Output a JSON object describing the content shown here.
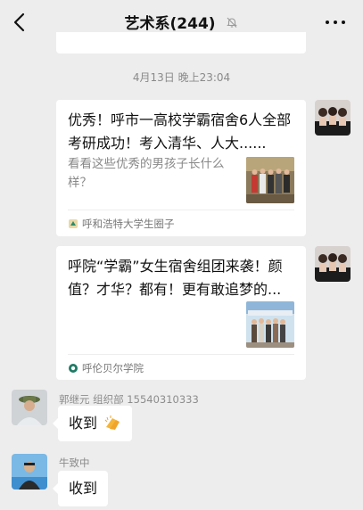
{
  "header": {
    "title": "艺术系(244)"
  },
  "timestamp": "4月13日 晚上23:04",
  "cards": [
    {
      "title": "优秀！呼市一高校学霸宿舍6人全部考研成功！考入清华、人大......",
      "description": "看看这些优秀的男孩子长什么样？",
      "source": "呼和浩特大学生圈子"
    },
    {
      "title": "呼院“学霸”女生宿舍组团来袭！颜值？才华？都有！更有敢追梦的...",
      "description": "",
      "source": "呼伦贝尔学院"
    }
  ],
  "messages": [
    {
      "sender": "郭继元 组织部 15540310333",
      "text": "收到"
    },
    {
      "sender": "牛致中",
      "text": "收到"
    }
  ],
  "colors": {
    "background": "#ededed",
    "bubble": "#ffffff",
    "meta_text": "#8a8a8a"
  },
  "icons": [
    "back-arrow-icon",
    "muted-bell-icon",
    "more-dots-icon",
    "source-logo-icon",
    "clapping-hands-emoji"
  ]
}
